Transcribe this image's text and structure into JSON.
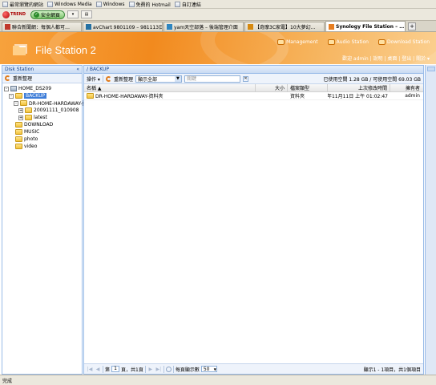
{
  "browser": {
    "favorites": [
      "最常瀏覽的網站",
      "Windows Media",
      "Windows",
      "免費的 Hotmail",
      "自訂連結"
    ],
    "toolbar": {
      "trend_label": "TREND",
      "safe_label": "安全網頁"
    },
    "tabs": [
      {
        "label": "聯合新聞網：每個人都可…"
      },
      {
        "label": "avChart 9801109 – 981113日…"
      },
      {
        "label": "yam天空部落 – 後端管理介面"
      },
      {
        "label": "【奇摩3C家電】10大夢幻…"
      },
      {
        "label": "Synology File Station – …",
        "active": true
      }
    ],
    "status": "完成"
  },
  "header": {
    "title": "File Station 2",
    "links": [
      "Management",
      "Audio Station",
      "Download Station"
    ],
    "user_line": "歡迎 admin | 說明 | 桌面 | 登出 | 關於 ▾"
  },
  "left": {
    "title": "Disk Station",
    "refresh_label": "重新整理",
    "tree": [
      {
        "label": "HOME_DS209",
        "level": 0,
        "icon": "server-icon",
        "exp": "-"
      },
      {
        "label": "BACKUP",
        "level": 1,
        "icon": "folder-icon",
        "exp": "-",
        "selected": true
      },
      {
        "label": "DR-HOME-HARDAWAY-資",
        "level": 2,
        "icon": "folder-icon",
        "exp": "-"
      },
      {
        "label": "20091111_010908",
        "level": 3,
        "icon": "folder-icon",
        "exp": "+"
      },
      {
        "label": "latest",
        "level": 3,
        "icon": "folder-icon",
        "exp": "+"
      },
      {
        "label": "DOWNLOAD",
        "level": 1,
        "icon": "folder-icon"
      },
      {
        "label": "MUSIC",
        "level": 1,
        "icon": "folder-icon"
      },
      {
        "label": "photo",
        "level": 1,
        "icon": "folder-icon"
      },
      {
        "label": "video",
        "level": 1,
        "icon": "folder-icon"
      }
    ]
  },
  "main": {
    "path": "/ BACKUP",
    "action_label": "操作",
    "refresh_label": "重新整理",
    "filter_value": "顯示全部",
    "search_placeholder": "關鍵",
    "usage": "已使用空間 1.28 GB / 可使用空間 69.03 GB",
    "columns": [
      "名稱 ▲",
      "大小",
      "檔案類型",
      "上次修改時間",
      "擁有者"
    ],
    "rows": [
      {
        "name": "DR-HOME-HARDAWAY-資料夾",
        "size": "",
        "type": "資料夾",
        "modified": "2009年11月11日 上午 01:02:47",
        "owner": "admin"
      }
    ],
    "pager": {
      "page_label": "第",
      "page_value": "1",
      "page_total": "頁，共1頁",
      "per_page_label": "每頁顯示數",
      "per_page_value": "50",
      "info": "顯示1 - 1項目，共1個項目"
    }
  }
}
